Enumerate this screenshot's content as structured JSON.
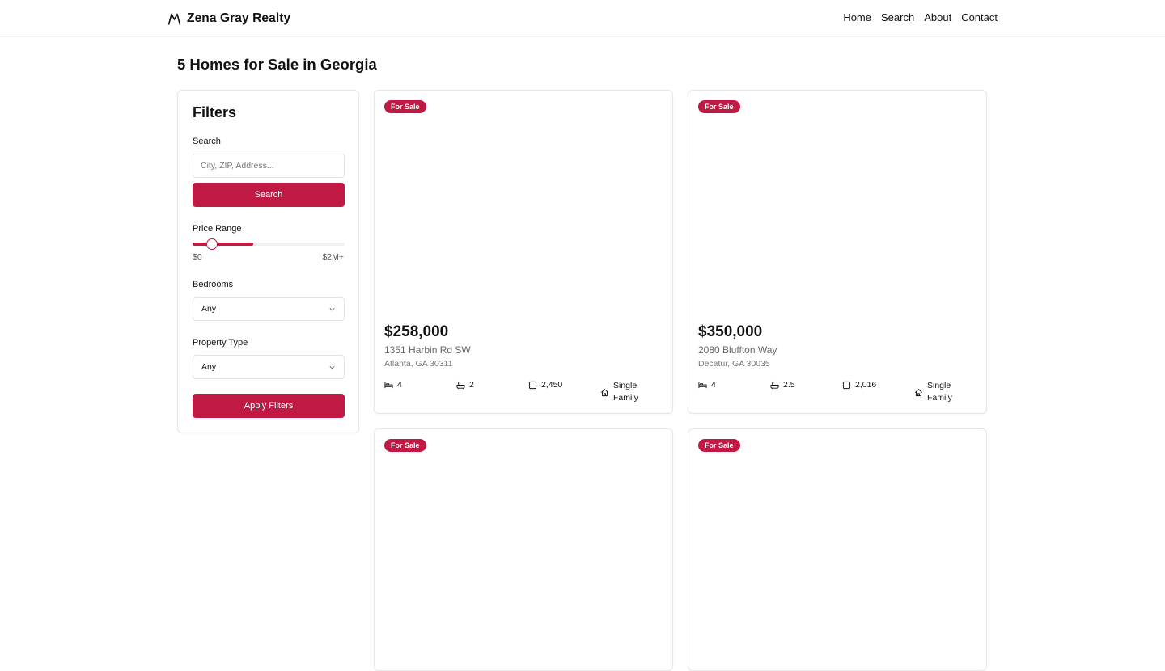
{
  "header": {
    "brand": "Zena Gray Realty",
    "nav": [
      "Home",
      "Search",
      "About",
      "Contact"
    ]
  },
  "page_title": "5 Homes for Sale in Georgia",
  "filters": {
    "title": "Filters",
    "search_label": "Search",
    "search_placeholder": "City, ZIP, Address...",
    "search_button": "Search",
    "price_label": "Price Range",
    "price_min": "$0",
    "price_max": "$2M+",
    "price_fill_fraction": 0.4,
    "price_thumb_fraction": 0.13,
    "bedrooms_label": "Bedrooms",
    "bedrooms_value": "Any",
    "type_label": "Property Type",
    "type_value": "Any",
    "apply_button": "Apply Filters"
  },
  "colors": {
    "accent": "#c01a44"
  },
  "listings": [
    {
      "badge": "For Sale",
      "price": "$258,000",
      "street": "1351 Harbin Rd SW",
      "city": "Atlanta, GA 30311",
      "beds": "4",
      "baths": "2",
      "sqft": "2,450",
      "type": "Single Family"
    },
    {
      "badge": "For Sale",
      "price": "$350,000",
      "street": "2080 Bluffton Way",
      "city": "Decatur, GA 30035",
      "beds": "4",
      "baths": "2.5",
      "sqft": "2,016",
      "type": "Single Family"
    },
    {
      "badge": "For Sale"
    },
    {
      "badge": "For Sale"
    }
  ]
}
